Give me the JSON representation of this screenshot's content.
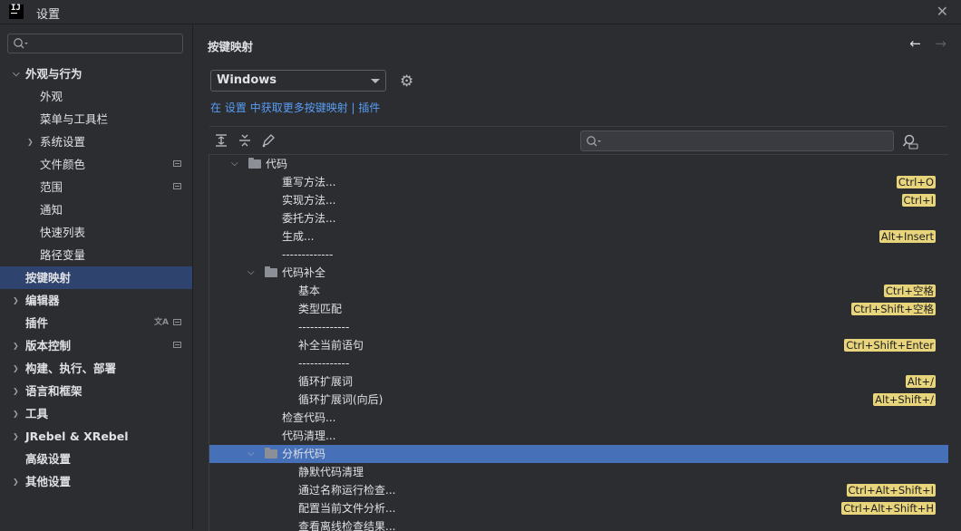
{
  "window": {
    "title": "设置",
    "logo_text": "IJ"
  },
  "sidebar": {
    "search_placeholder": "",
    "items": [
      {
        "label": "外观与行为",
        "arrow": "⌄",
        "indent": 0,
        "bold": true
      },
      {
        "label": "外观",
        "indent": 1
      },
      {
        "label": "菜单与工具栏",
        "indent": 1
      },
      {
        "label": "系统设置",
        "arrow": "›",
        "indent": 1
      },
      {
        "label": "文件颜色",
        "indent": 1,
        "badge": true
      },
      {
        "label": "范围",
        "indent": 1,
        "badge": true
      },
      {
        "label": "通知",
        "indent": 1
      },
      {
        "label": "快速列表",
        "indent": 1
      },
      {
        "label": "路径变量",
        "indent": 1
      },
      {
        "label": "按键映射",
        "indent": 0,
        "bold": true,
        "selected": true
      },
      {
        "label": "编辑器",
        "arrow": "›",
        "indent": 0,
        "bold": true
      },
      {
        "label": "插件",
        "indent": 0,
        "bold": true,
        "badge": true,
        "translate": true
      },
      {
        "label": "版本控制",
        "arrow": "›",
        "indent": 0,
        "bold": true,
        "badge": true
      },
      {
        "label": "构建、执行、部署",
        "arrow": "›",
        "indent": 0,
        "bold": true
      },
      {
        "label": "语言和框架",
        "arrow": "›",
        "indent": 0,
        "bold": true
      },
      {
        "label": "工具",
        "arrow": "›",
        "indent": 0,
        "bold": true
      },
      {
        "label": "JRebel & XRebel",
        "arrow": "›",
        "indent": 0,
        "bold": true
      },
      {
        "label": "高级设置",
        "indent": 0,
        "bold": true
      },
      {
        "label": "其他设置",
        "arrow": "›",
        "indent": 0,
        "bold": true
      }
    ]
  },
  "main": {
    "title": "按键映射",
    "keymap": "Windows",
    "get_more": {
      "prefix": "在",
      "settings": "设置",
      "middle": "中获取更多按键映射",
      "sep": "|",
      "plugins": "插件"
    },
    "actions_search_placeholder": "",
    "actions": [
      {
        "label": "代码",
        "level": 0,
        "folder": true,
        "expanded": true
      },
      {
        "label": "重写方法...",
        "level": 1,
        "shortcut": "Ctrl+O"
      },
      {
        "label": "实现方法...",
        "level": 1,
        "shortcut": "Ctrl+I"
      },
      {
        "label": "委托方法...",
        "level": 1
      },
      {
        "label": "生成...",
        "level": 1,
        "shortcut": "Alt+Insert"
      },
      {
        "label": "-------------",
        "level": 1
      },
      {
        "label": "代码补全",
        "level": 1,
        "folder": true,
        "expanded": true
      },
      {
        "label": "基本",
        "level": 2,
        "shortcut": "Ctrl+空格"
      },
      {
        "label": "类型匹配",
        "level": 2,
        "shortcut": "Ctrl+Shift+空格"
      },
      {
        "label": "-------------",
        "level": 2
      },
      {
        "label": "补全当前语句",
        "level": 2,
        "shortcut": "Ctrl+Shift+Enter"
      },
      {
        "label": "-------------",
        "level": 2
      },
      {
        "label": "循环扩展词",
        "level": 2,
        "shortcut": "Alt+/"
      },
      {
        "label": "循环扩展词(向后)",
        "level": 2,
        "shortcut": "Alt+Shift+/"
      },
      {
        "label": "检查代码...",
        "level": 1
      },
      {
        "label": "代码清理...",
        "level": 1
      },
      {
        "label": "分析代码",
        "level": 1,
        "folder": true,
        "expanded": true,
        "selected": true
      },
      {
        "label": "静默代码清理",
        "level": 2
      },
      {
        "label": "通过名称运行检查...",
        "level": 2,
        "shortcut": "Ctrl+Alt+Shift+I"
      },
      {
        "label": "配置当前文件分析...",
        "level": 2,
        "shortcut": "Ctrl+Alt+Shift+H"
      },
      {
        "label": "查看离线检查结果...",
        "level": 2
      }
    ]
  }
}
